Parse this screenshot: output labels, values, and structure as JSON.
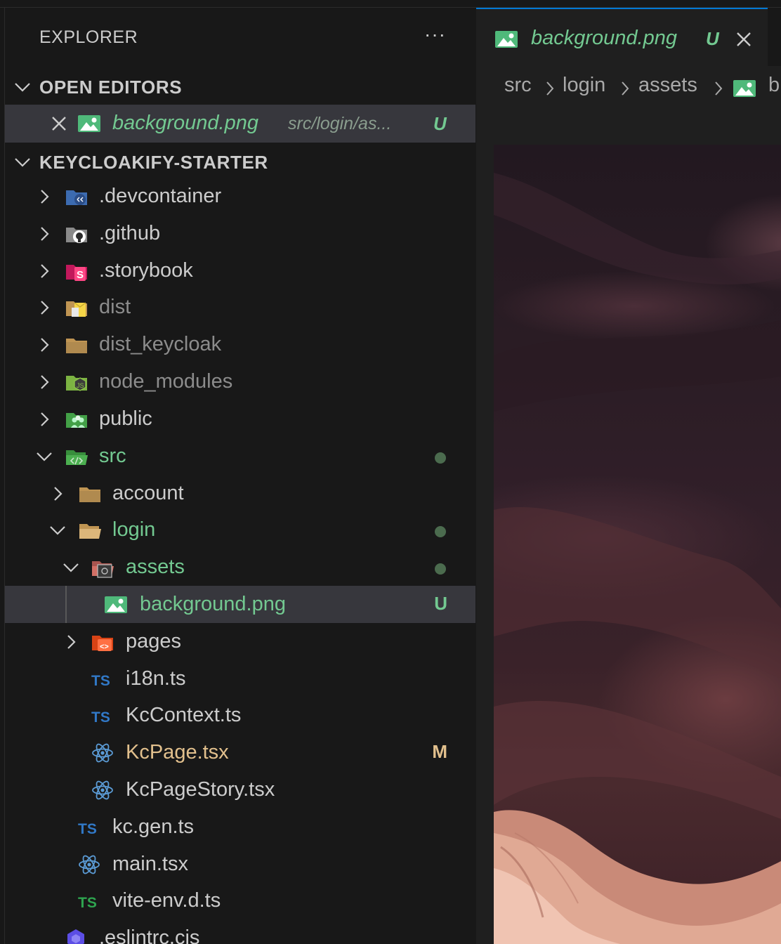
{
  "explorer": {
    "title": "EXPLORER",
    "more": "···"
  },
  "open_editors": {
    "label": "OPEN EDITORS",
    "items": [
      {
        "name": "background.png",
        "path": "src/login/as...",
        "decoration": "U"
      }
    ]
  },
  "workspace": {
    "label": "KEYCLOAKIFY-STARTER",
    "tree": [
      {
        "name": ".devcontainer",
        "icon": "devcontainer-folder-icon"
      },
      {
        "name": ".github",
        "icon": "github-folder-icon"
      },
      {
        "name": ".storybook",
        "icon": "storybook-folder-icon"
      },
      {
        "name": "dist",
        "icon": "dist-folder-icon"
      },
      {
        "name": "dist_keycloak",
        "icon": "folder-icon"
      },
      {
        "name": "node_modules",
        "icon": "node-folder-icon"
      },
      {
        "name": "public",
        "icon": "public-folder-icon"
      },
      {
        "name": "src",
        "icon": "src-folder-icon"
      },
      {
        "name": "account",
        "icon": "folder-icon"
      },
      {
        "name": "login",
        "icon": "folder-open-icon"
      },
      {
        "name": "assets",
        "icon": "assets-folder-icon"
      },
      {
        "name": "background.png",
        "icon": "image-file-icon",
        "decoration": "U"
      },
      {
        "name": "pages",
        "icon": "pages-folder-icon"
      },
      {
        "name": "i18n.ts",
        "icon": "typescript-icon"
      },
      {
        "name": "KcContext.ts",
        "icon": "typescript-icon"
      },
      {
        "name": "KcPage.tsx",
        "icon": "react-icon",
        "decoration": "M"
      },
      {
        "name": "KcPageStory.tsx",
        "icon": "react-icon"
      },
      {
        "name": "kc.gen.ts",
        "icon": "typescript-icon"
      },
      {
        "name": "main.tsx",
        "icon": "react-icon"
      },
      {
        "name": "vite-env.d.ts",
        "icon": "typescript-def-icon"
      },
      {
        "name": ".eslintrc.cjs",
        "icon": "eslint-icon"
      }
    ]
  },
  "editor": {
    "tab": {
      "name": "background.png",
      "decoration": "U"
    },
    "breadcrumbs": [
      "src",
      "login",
      "assets",
      "b"
    ]
  },
  "colors": {
    "untracked": "#73c991",
    "modified": "#e2c08d",
    "accent": "#0078d4",
    "selection": "#37373d"
  }
}
